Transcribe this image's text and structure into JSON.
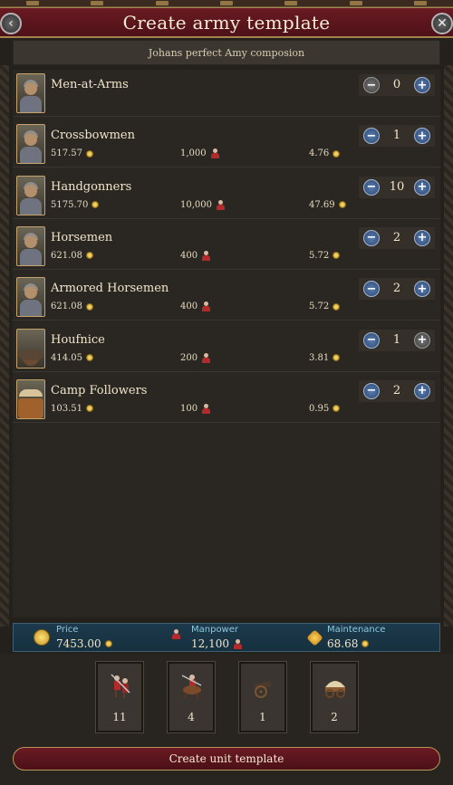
{
  "window": {
    "title": "Create army template",
    "subtitle": "Johans perfect Amy composion"
  },
  "units": [
    {
      "name": "Men-at-Arms",
      "count": "0",
      "portrait": "men-at-arms-portrait",
      "price": "",
      "manpower": "",
      "maintenance": "",
      "minus_enabled": false
    },
    {
      "name": "Crossbowmen",
      "count": "1",
      "portrait": "crossbowmen-portrait",
      "price": "517.57",
      "manpower": "1,000",
      "maintenance": "4.76",
      "minus_enabled": true
    },
    {
      "name": "Handgonners",
      "count": "10",
      "portrait": "handgonners-portrait",
      "price": "5175.70",
      "manpower": "10,000",
      "maintenance": "47.69",
      "minus_enabled": true
    },
    {
      "name": "Horsemen",
      "count": "2",
      "portrait": "horsemen-portrait",
      "price": "621.08",
      "manpower": "400",
      "maintenance": "5.72",
      "minus_enabled": true
    },
    {
      "name": "Armored Horsemen",
      "count": "2",
      "portrait": "armored-horsemen-portrait",
      "price": "621.08",
      "manpower": "400",
      "maintenance": "5.72",
      "minus_enabled": true
    },
    {
      "name": "Houfnice",
      "count": "1",
      "portrait": "houfnice-portrait",
      "price": "414.05",
      "manpower": "200",
      "maintenance": "3.81",
      "minus_enabled": true
    },
    {
      "name": "Camp Followers",
      "count": "2",
      "portrait": "camp-followers-portrait",
      "price": "103.51",
      "manpower": "100",
      "maintenance": "0.95",
      "minus_enabled": true
    }
  ],
  "summary": {
    "price_label": "Price",
    "price_value": "7453.00",
    "manpower_label": "Manpower",
    "manpower_value": "12,100",
    "maintenance_label": "Maintenance",
    "maintenance_value": "68.68"
  },
  "type_cards": [
    {
      "icon": "infantry-icon",
      "count": "11"
    },
    {
      "icon": "cavalry-icon",
      "count": "4"
    },
    {
      "icon": "cannon-icon",
      "count": "1"
    },
    {
      "icon": "wagon-icon",
      "count": "2"
    }
  ],
  "actions": {
    "create_label": "Create unit template"
  },
  "icons": {
    "back": "‹",
    "close": "✕",
    "minus": "−",
    "plus": "+"
  },
  "colors": {
    "title_bar": "#5a141c",
    "summary_bar": "#1c3a4c",
    "stepper_button": "#3f6192",
    "coin": "#e8b93a"
  }
}
